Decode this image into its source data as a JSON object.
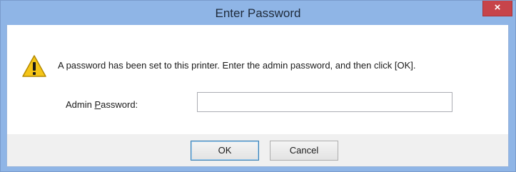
{
  "window": {
    "title": "Enter Password",
    "close_label": "×"
  },
  "icon": {
    "name": "warning-icon",
    "color": "#f0c020"
  },
  "message": "A password has been set to this printer. Enter the admin password, and then click [OK].",
  "field": {
    "label_prefix": "Admin ",
    "label_mnemonic": "P",
    "label_suffix": "assword:",
    "value": "",
    "placeholder": ""
  },
  "buttons": {
    "ok_label": "OK",
    "cancel_label": "Cancel"
  },
  "colors": {
    "titlebar": "#8fb5e6",
    "close_button": "#c7444a"
  }
}
